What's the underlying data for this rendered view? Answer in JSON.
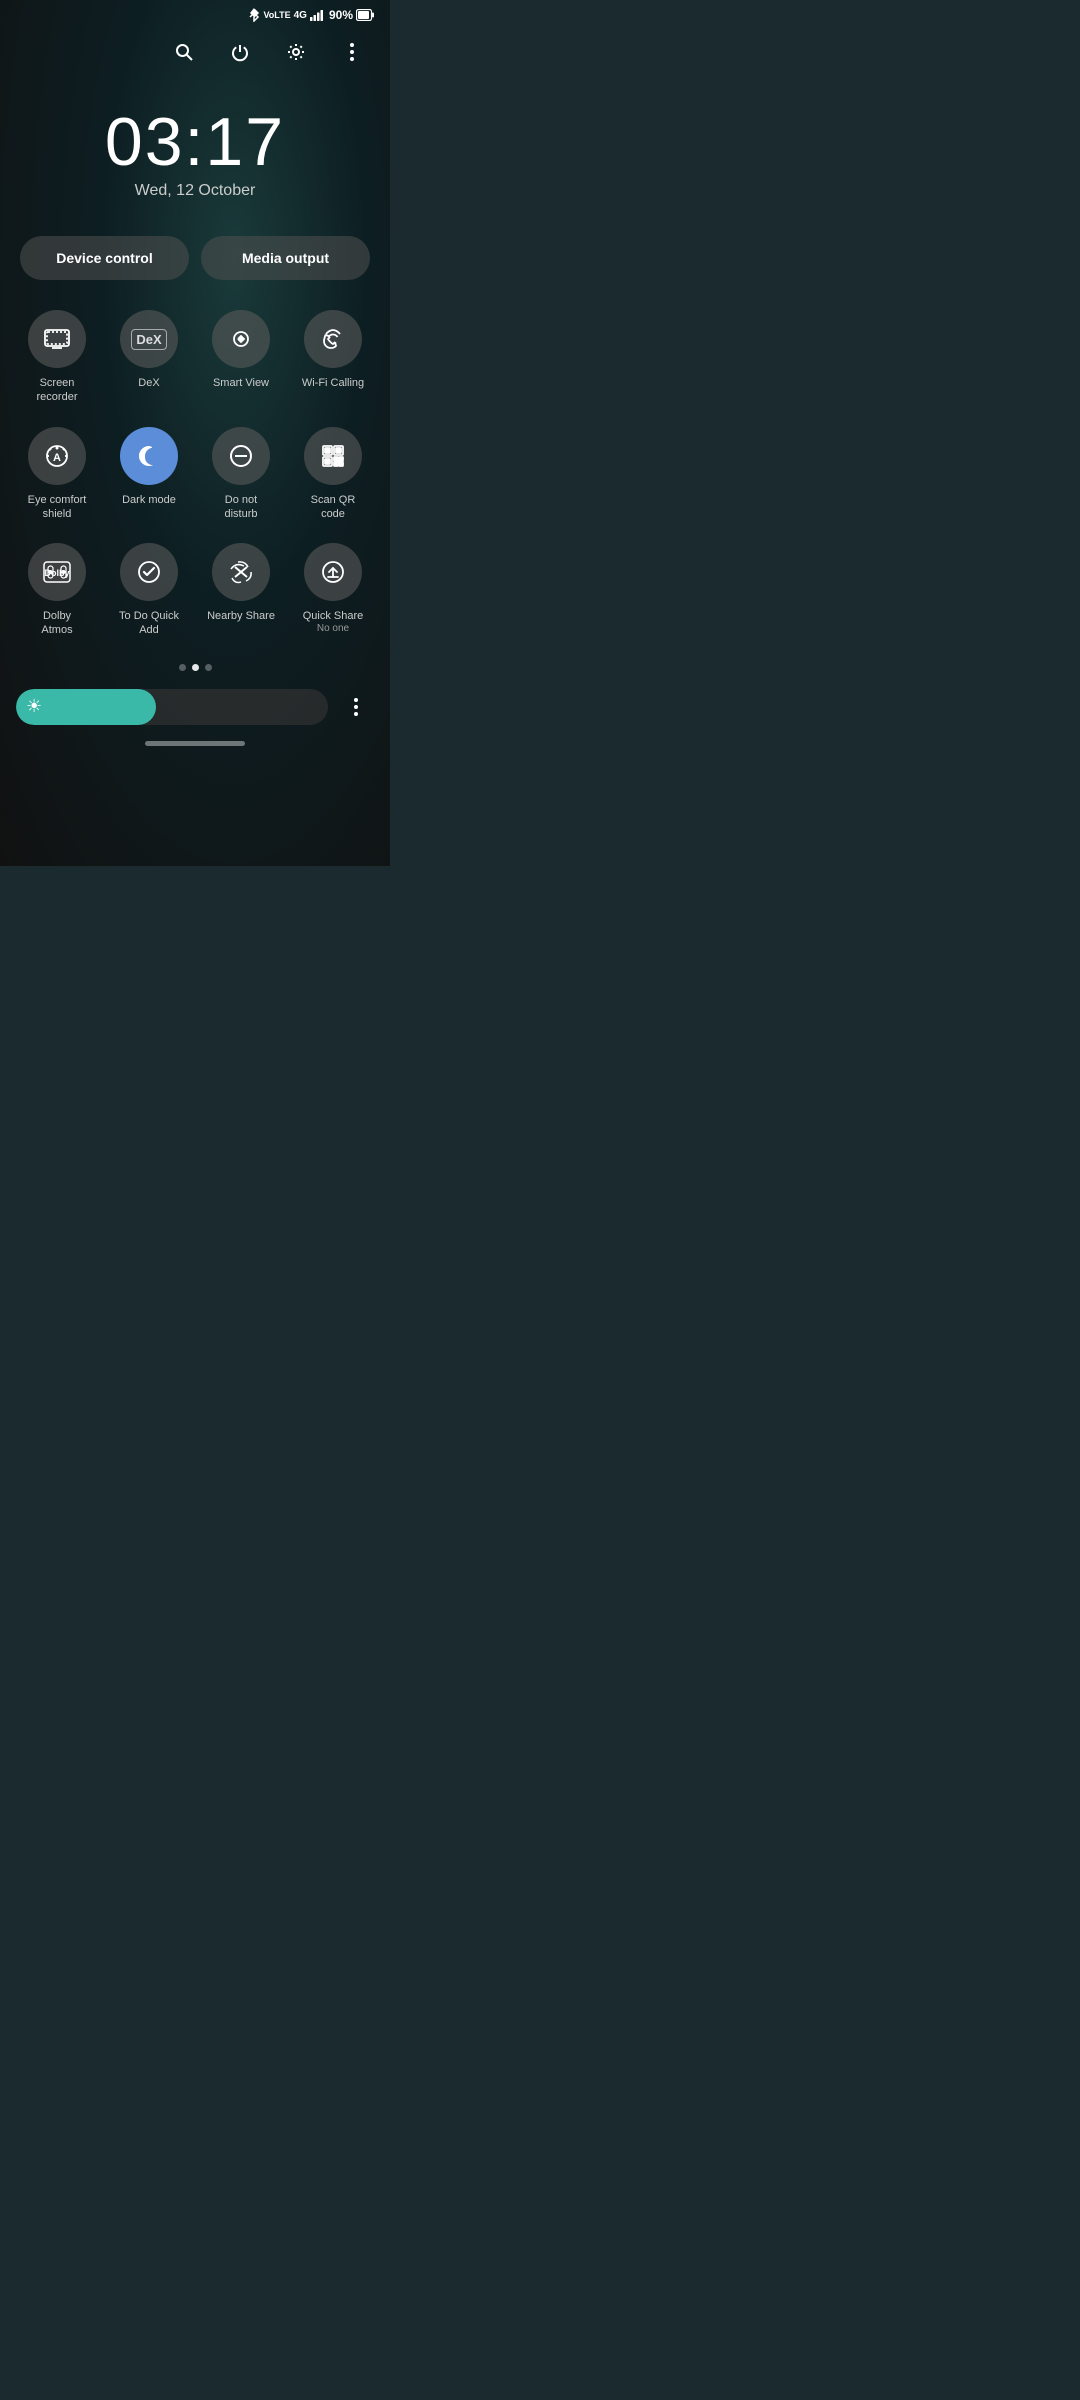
{
  "statusBar": {
    "battery": "90%",
    "signal": "4G",
    "icons": [
      "bluetooth",
      "volte",
      "4g",
      "signal",
      "battery"
    ]
  },
  "topControls": {
    "search": "🔍",
    "power": "⏻",
    "settings": "⚙",
    "more": "⋮"
  },
  "clock": {
    "time": "03:17",
    "date": "Wed, 12 October"
  },
  "controlButtons": [
    {
      "id": "device-control",
      "label": "Device control"
    },
    {
      "id": "media-output",
      "label": "Media output"
    }
  ],
  "quickSettings": {
    "rows": [
      [
        {
          "id": "screen-recorder",
          "label": "Screen\nrecorder",
          "sublabel": "",
          "active": false,
          "icon": "screen-recorder"
        },
        {
          "id": "dex",
          "label": "DeX",
          "sublabel": "",
          "active": false,
          "icon": "dex"
        },
        {
          "id": "smart-view",
          "label": "Smart View",
          "sublabel": "",
          "active": false,
          "icon": "smart-view"
        },
        {
          "id": "wifi-calling",
          "label": "Wi-Fi Calling",
          "sublabel": "",
          "active": false,
          "icon": "wifi-calling"
        }
      ],
      [
        {
          "id": "eye-comfort",
          "label": "Eye comfort\nshield",
          "sublabel": "",
          "active": false,
          "icon": "eye-comfort"
        },
        {
          "id": "dark-mode",
          "label": "Dark mode",
          "sublabel": "",
          "active": true,
          "icon": "dark-mode"
        },
        {
          "id": "do-not-disturb",
          "label": "Do not\ndisturb",
          "sublabel": "",
          "active": false,
          "icon": "do-not-disturb"
        },
        {
          "id": "scan-qr",
          "label": "Scan QR\ncode",
          "sublabel": "",
          "active": false,
          "icon": "scan-qr"
        }
      ],
      [
        {
          "id": "dolby-atmos",
          "label": "Dolby\nAtmos",
          "sublabel": "",
          "active": false,
          "icon": "dolby-atmos"
        },
        {
          "id": "todo-quick-add",
          "label": "To Do Quick\nAdd",
          "sublabel": "",
          "active": false,
          "icon": "todo-quick-add"
        },
        {
          "id": "nearby-share",
          "label": "Nearby Share",
          "sublabel": "",
          "active": false,
          "icon": "nearby-share"
        },
        {
          "id": "quick-share",
          "label": "Quick Share",
          "sublabel": "No one",
          "active": false,
          "icon": "quick-share"
        }
      ]
    ]
  },
  "pageDots": [
    false,
    true,
    false
  ],
  "brightness": {
    "level": 45,
    "iconLabel": "☀"
  }
}
